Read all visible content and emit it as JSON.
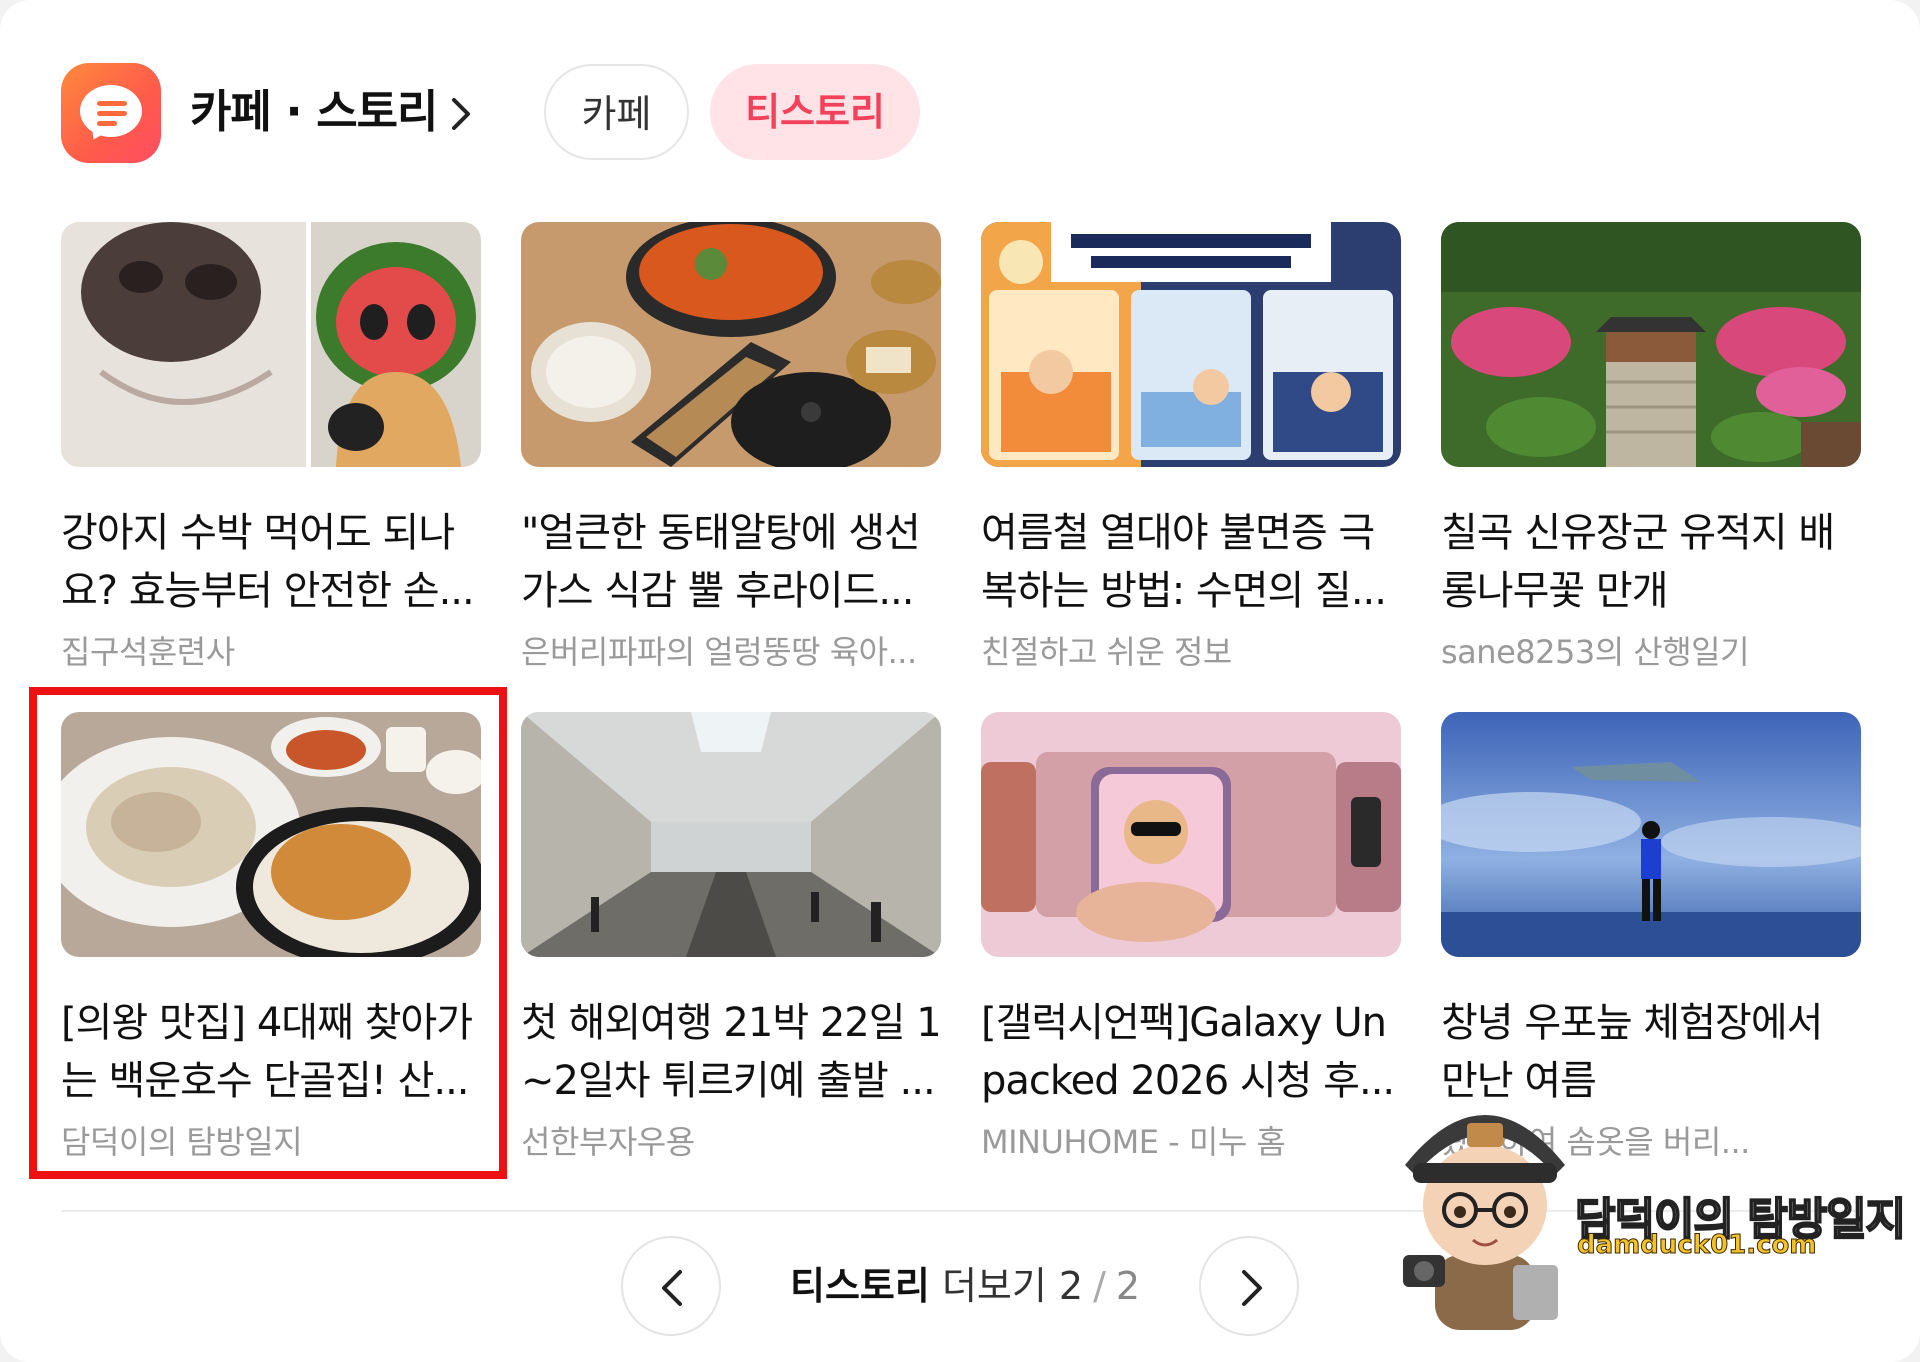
{
  "header": {
    "title": "카페 · 스토리",
    "tabs": [
      {
        "label": "카페",
        "active": false
      },
      {
        "label": "티스토리",
        "active": true
      }
    ],
    "accent_color": "#f2425b"
  },
  "posts": [
    {
      "title": "강아지 수박 먹어도 되나요? 효능부터 안전한 손...",
      "source": "집구석훈련사",
      "thumb": "dog-watermelon-photo"
    },
    {
      "title": "\"얼큰한 동태알탕에 생선가스 식감 뿔 후라이드...",
      "source": "은버리파파의 얼렁뚱땅 육아...",
      "thumb": "korean-table-food-photo"
    },
    {
      "title": "여름철 열대야 불면증 극복하는 방법: 수면의 질...",
      "source": "친절하고 쉬운 정보",
      "thumb": "sleep-infographic"
    },
    {
      "title": "칠곡 신유장군 유적지 배롱나무꽃 만개",
      "source": "sane8253의 산행일기",
      "thumb": "shrine-aerial-photo"
    },
    {
      "title": "[의왕 맛집] 4대째 찾아가는 백운호수 단골집! 산...",
      "source": "담덕이의 탐방일지",
      "thumb": "chicken-porridge-photo",
      "highlighted": true
    },
    {
      "title": "첫 해외여행 21박 22일 1~2일차 튀르키예 출발 ...",
      "source": "선한부자우용",
      "thumb": "airport-hall-photo"
    },
    {
      "title": "[갤럭시언팩]Galaxy Unpacked 2026 시청 후...",
      "source": "MINUHOME - 미누 홈",
      "thumb": "phone-cat-photo"
    },
    {
      "title": "창녕 우포늪 체험장에서 만난 여름",
      "source": "왔다하여 솜옷을 버리...",
      "thumb": "blue-art-room-photo"
    }
  ],
  "pagination": {
    "label_bold": "티스토리",
    "label": "더보기",
    "current": "2",
    "separator": "/",
    "total": "2"
  },
  "watermark": {
    "name": "담덕이의 탐방일지",
    "url": "damduck01.com"
  }
}
